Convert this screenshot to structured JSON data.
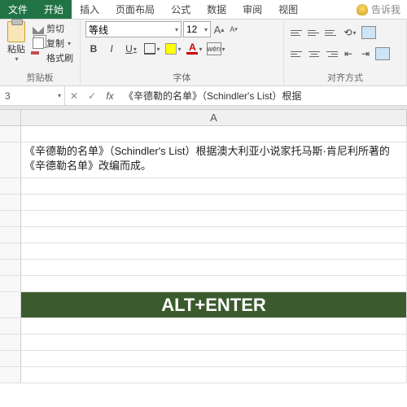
{
  "tabs": {
    "file": "文件",
    "home": "开始",
    "insert": "插入",
    "layout": "页面布局",
    "formulas": "公式",
    "data": "数据",
    "review": "审阅",
    "view": "视图"
  },
  "tellme": "告诉我",
  "clipboard": {
    "paste": "粘贴",
    "cut": "剪切",
    "copy": "复制",
    "brush": "格式刷",
    "group": "剪贴板"
  },
  "font": {
    "name": "等线",
    "size": "12",
    "group": "字体",
    "bold": "B",
    "italic": "I",
    "underline": "U",
    "wen": "wén"
  },
  "align": {
    "group": "对齐方式"
  },
  "namebox": "3",
  "fx": "fx",
  "formula_text": "《辛德勒的名单》（Schindler's List）根据",
  "colA": "A",
  "cell_text": "《辛德勒的名单》（Schindler's List）根据澳大利亚小说家托马斯·肯尼利所著的《辛德勒名单》改编而成。",
  "banner": "ALT+ENTER"
}
